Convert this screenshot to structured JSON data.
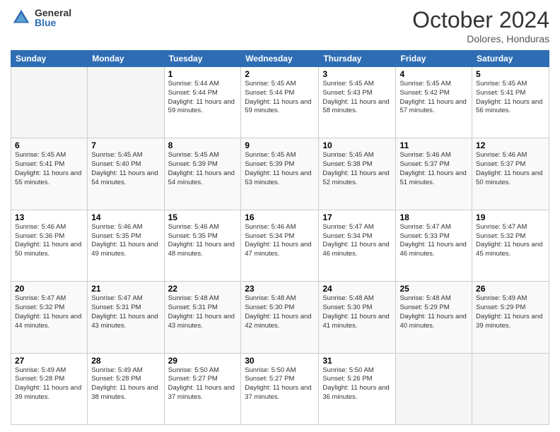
{
  "logo": {
    "general": "General",
    "blue": "Blue"
  },
  "header": {
    "month": "October 2024",
    "location": "Dolores, Honduras"
  },
  "days_of_week": [
    "Sunday",
    "Monday",
    "Tuesday",
    "Wednesday",
    "Thursday",
    "Friday",
    "Saturday"
  ],
  "weeks": [
    [
      {
        "day": "",
        "empty": true
      },
      {
        "day": "",
        "empty": true
      },
      {
        "day": "1",
        "sunrise": "5:44 AM",
        "sunset": "5:44 PM",
        "daylight": "11 hours and 59 minutes."
      },
      {
        "day": "2",
        "sunrise": "5:45 AM",
        "sunset": "5:44 PM",
        "daylight": "11 hours and 59 minutes."
      },
      {
        "day": "3",
        "sunrise": "5:45 AM",
        "sunset": "5:43 PM",
        "daylight": "11 hours and 58 minutes."
      },
      {
        "day": "4",
        "sunrise": "5:45 AM",
        "sunset": "5:42 PM",
        "daylight": "11 hours and 57 minutes."
      },
      {
        "day": "5",
        "sunrise": "5:45 AM",
        "sunset": "5:41 PM",
        "daylight": "11 hours and 56 minutes."
      }
    ],
    [
      {
        "day": "6",
        "sunrise": "5:45 AM",
        "sunset": "5:41 PM",
        "daylight": "11 hours and 55 minutes."
      },
      {
        "day": "7",
        "sunrise": "5:45 AM",
        "sunset": "5:40 PM",
        "daylight": "11 hours and 54 minutes."
      },
      {
        "day": "8",
        "sunrise": "5:45 AM",
        "sunset": "5:39 PM",
        "daylight": "11 hours and 54 minutes."
      },
      {
        "day": "9",
        "sunrise": "5:45 AM",
        "sunset": "5:39 PM",
        "daylight": "11 hours and 53 minutes."
      },
      {
        "day": "10",
        "sunrise": "5:45 AM",
        "sunset": "5:38 PM",
        "daylight": "11 hours and 52 minutes."
      },
      {
        "day": "11",
        "sunrise": "5:46 AM",
        "sunset": "5:37 PM",
        "daylight": "11 hours and 51 minutes."
      },
      {
        "day": "12",
        "sunrise": "5:46 AM",
        "sunset": "5:37 PM",
        "daylight": "11 hours and 50 minutes."
      }
    ],
    [
      {
        "day": "13",
        "sunrise": "5:46 AM",
        "sunset": "5:36 PM",
        "daylight": "11 hours and 50 minutes."
      },
      {
        "day": "14",
        "sunrise": "5:46 AM",
        "sunset": "5:35 PM",
        "daylight": "11 hours and 49 minutes."
      },
      {
        "day": "15",
        "sunrise": "5:46 AM",
        "sunset": "5:35 PM",
        "daylight": "11 hours and 48 minutes."
      },
      {
        "day": "16",
        "sunrise": "5:46 AM",
        "sunset": "5:34 PM",
        "daylight": "11 hours and 47 minutes."
      },
      {
        "day": "17",
        "sunrise": "5:47 AM",
        "sunset": "5:34 PM",
        "daylight": "11 hours and 46 minutes."
      },
      {
        "day": "18",
        "sunrise": "5:47 AM",
        "sunset": "5:33 PM",
        "daylight": "11 hours and 46 minutes."
      },
      {
        "day": "19",
        "sunrise": "5:47 AM",
        "sunset": "5:32 PM",
        "daylight": "11 hours and 45 minutes."
      }
    ],
    [
      {
        "day": "20",
        "sunrise": "5:47 AM",
        "sunset": "5:32 PM",
        "daylight": "11 hours and 44 minutes."
      },
      {
        "day": "21",
        "sunrise": "5:47 AM",
        "sunset": "5:31 PM",
        "daylight": "11 hours and 43 minutes."
      },
      {
        "day": "22",
        "sunrise": "5:48 AM",
        "sunset": "5:31 PM",
        "daylight": "11 hours and 43 minutes."
      },
      {
        "day": "23",
        "sunrise": "5:48 AM",
        "sunset": "5:30 PM",
        "daylight": "11 hours and 42 minutes."
      },
      {
        "day": "24",
        "sunrise": "5:48 AM",
        "sunset": "5:30 PM",
        "daylight": "11 hours and 41 minutes."
      },
      {
        "day": "25",
        "sunrise": "5:48 AM",
        "sunset": "5:29 PM",
        "daylight": "11 hours and 40 minutes."
      },
      {
        "day": "26",
        "sunrise": "5:49 AM",
        "sunset": "5:29 PM",
        "daylight": "11 hours and 39 minutes."
      }
    ],
    [
      {
        "day": "27",
        "sunrise": "5:49 AM",
        "sunset": "5:28 PM",
        "daylight": "11 hours and 39 minutes."
      },
      {
        "day": "28",
        "sunrise": "5:49 AM",
        "sunset": "5:28 PM",
        "daylight": "11 hours and 38 minutes."
      },
      {
        "day": "29",
        "sunrise": "5:50 AM",
        "sunset": "5:27 PM",
        "daylight": "11 hours and 37 minutes."
      },
      {
        "day": "30",
        "sunrise": "5:50 AM",
        "sunset": "5:27 PM",
        "daylight": "11 hours and 37 minutes."
      },
      {
        "day": "31",
        "sunrise": "5:50 AM",
        "sunset": "5:26 PM",
        "daylight": "11 hours and 36 minutes."
      },
      {
        "day": "",
        "empty": true
      },
      {
        "day": "",
        "empty": true
      }
    ]
  ]
}
